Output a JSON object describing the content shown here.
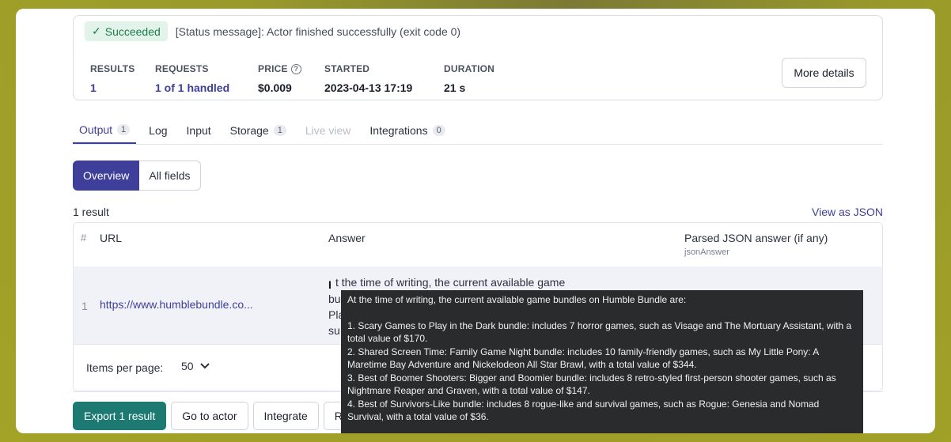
{
  "status": {
    "badge": "Succeeded",
    "message": "[Status message]: Actor finished successfully (exit code 0)"
  },
  "stats": [
    {
      "label": "RESULTS",
      "value": "1",
      "link": true
    },
    {
      "label": "REQUESTS",
      "value": "1 of 1 handled",
      "link": true
    },
    {
      "label": "PRICE",
      "value": "$0.009",
      "link": false,
      "help": true
    },
    {
      "label": "STARTED",
      "value": "2023-04-13 17:19",
      "link": false
    },
    {
      "label": "DURATION",
      "value": "21 s",
      "link": false
    }
  ],
  "more_details": "More details",
  "tabs": [
    {
      "label": "Output",
      "count": "1",
      "active": true
    },
    {
      "label": "Log"
    },
    {
      "label": "Input"
    },
    {
      "label": "Storage",
      "count": "1"
    },
    {
      "label": "Live view",
      "disabled": true
    },
    {
      "label": "Integrations",
      "count": "0"
    }
  ],
  "view_toggle": {
    "overview": "Overview",
    "all_fields": "All fields"
  },
  "result_count": "1 result",
  "view_as_json": "View as JSON",
  "table": {
    "headers": {
      "index": "#",
      "url": "URL",
      "answer": "Answer",
      "parsed": "Parsed JSON answer (if any)",
      "parsed_sub": "jsonAnswer"
    },
    "row": {
      "index": "1",
      "url": "https://www.humblebundle.co...",
      "answer_lines": [
        "t the time of writing, the current available game",
        "bu",
        "Pla",
        "su"
      ]
    },
    "items_per_page_label": "Items per page:",
    "items_per_page_value": "50"
  },
  "actions": [
    "Export 1 result",
    "Go to actor",
    "Integrate",
    "R"
  ],
  "tooltip": {
    "intro": "At the time of writing, the current available game bundles on Humble Bundle are:",
    "items": [
      "1. Scary Games to Play in the Dark bundle: includes 7 horror games, such as Visage and The Mortuary Assistant, with a total value of $170.",
      "2. Shared Screen Time: Family Game Night bundle: includes 10 family-friendly games, such as My Little Pony: A Maretime Bay Adventure and Nickelodeon All Star Brawl, with a total value of $344.",
      "3. Best of Boomer Shooters: Bigger and Boomier bundle: includes 8 retro-styled first-person shooter games, such as Nightmare Reaper and Graven, with a total value of $147.",
      "4. Best of Survivors-Like bundle: includes 8 rogue-like and survival games, such as Rogue: Genesia and Nomad Survival, with a total value of $36."
    ]
  }
}
